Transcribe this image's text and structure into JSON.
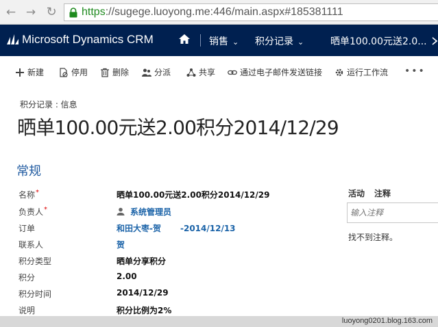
{
  "browser": {
    "url_secure": "https",
    "url_rest": "://sugege.luoyong.me:446/main.aspx#185381111"
  },
  "crm": {
    "app_title": "Microsoft Dynamics CRM",
    "nav": {
      "sales": "销售",
      "records": "积分记录",
      "current": "晒单100.00元送2.0..."
    }
  },
  "toolbar": {
    "new": "新建",
    "deactivate": "停用",
    "delete": "删除",
    "assign": "分派",
    "share": "共享",
    "email_link": "通过电子邮件发送链接",
    "run_workflow": "运行工作流",
    "more": "•••"
  },
  "header": {
    "entity_label": "积分记录 : 信息",
    "title": "晒单100.00元送2.00积分2014/12/29"
  },
  "section": {
    "title": "常规"
  },
  "fields": {
    "name_label": "名称",
    "name_value": "晒单100.00元送2.00积分2014/12/29",
    "owner_label": "负责人",
    "owner_value": "系统管理员",
    "order_label": "订单",
    "order_value_a": "和田大枣-贺",
    "order_value_b": "-2014/12/13",
    "contact_label": "联系人",
    "contact_value": "贺",
    "type_label": "积分类型",
    "type_value": "晒单分享积分",
    "points_label": "积分",
    "points_value": "2.00",
    "time_label": "积分时间",
    "time_value": "2014/12/29",
    "desc_label": "说明",
    "desc_value": "积分比例为2%"
  },
  "notes_panel": {
    "tab_activity": "活动",
    "tab_notes": "注释",
    "input_placeholder": "输入注释",
    "empty_text": "找不到注释。"
  },
  "footer": {
    "watermark": "luoyong0201.blog.163.com"
  },
  "colors": {
    "crm_bar": "#002050",
    "link": "#1b63a8",
    "section_title": "#1f5aa0",
    "required": "#d00000",
    "secure_green": "#1e8a1e"
  }
}
